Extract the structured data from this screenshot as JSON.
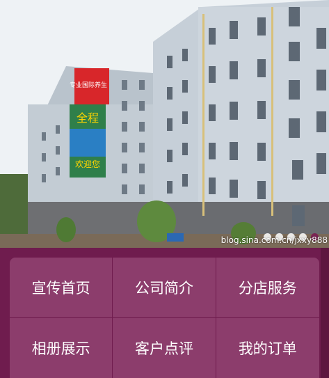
{
  "banner": {
    "watermark": "blog.sina.com.cn/jxxy888",
    "slide_count": 5,
    "active_slide": 5,
    "sign_text_top": "专业国际养生",
    "sign_text_mid": "全程",
    "sign_text_bottom": "欢迎您"
  },
  "menu": {
    "items": [
      {
        "label": "宣传首页"
      },
      {
        "label": "公司简介"
      },
      {
        "label": "分店服务"
      },
      {
        "label": "相册展示"
      },
      {
        "label": "客户点评"
      },
      {
        "label": "我的订单"
      }
    ]
  },
  "colors": {
    "background": "#6f1c4e",
    "menu_tile": "#8c3d6c"
  }
}
